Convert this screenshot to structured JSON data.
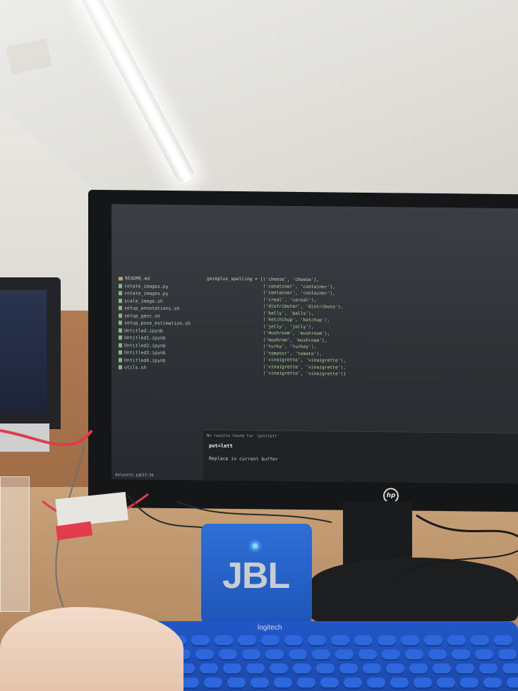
{
  "monitor": {
    "brand_logo": "hp",
    "screen": {
      "file_tree": [
        {
          "name": "README.md",
          "kind": "folder"
        },
        {
          "name": "rotate_images.py",
          "kind": "file"
        },
        {
          "name": "rotate_images.py",
          "kind": "file"
        },
        {
          "name": "scale_image.sh",
          "kind": "file"
        },
        {
          "name": "setup_annotations.sh",
          "kind": "file"
        },
        {
          "name": "setup_ganc.sh",
          "kind": "file"
        },
        {
          "name": "setup_pose_estimation.sh",
          "kind": "file"
        },
        {
          "name": "Untitled.ipynb",
          "kind": "file"
        },
        {
          "name": "Untitled1.ipynb",
          "kind": "file"
        },
        {
          "name": "Untitled2.ipynb",
          "kind": "file"
        },
        {
          "name": "Untitled3.ipynb",
          "kind": "file"
        },
        {
          "name": "Untitled4.ipynb",
          "kind": "file"
        },
        {
          "name": "utils.sh",
          "kind": "file"
        }
      ],
      "code_lines": [
        "gazeplus_spelling = [('cheese', 'cheese'),",
        "                     ('conatiner', 'container'),",
        "                     ('container', 'container'),",
        "                     ('creal', 'cereal'),",
        "                     ('distributer', 'distributo'),",
        "                     ('bally', 'balls'),",
        "                     ('ketchchup', 'ketchup'),",
        "                     ('jelly', 'jelly'),",
        "                     ('mushroom', 'mushroom'),",
        "                     ('mushrom', 'mushroom'),",
        "                     ('turky', 'turkey'),",
        "                     ('tomator', 'tomato'),",
        "                     ('vinaigrette', 'vinaigrette'),",
        "                     ('vinaigrette', 'vinaigrette'),",
        "                     ('vinaigrette', 'vinaigrette')]"
      ],
      "search": {
        "message": "No results found for 'put=lett'",
        "query": "put=lett",
        "replace_label": "Replace in current buffer"
      },
      "status": {
        "file": "datasets.py",
        "position": "133:26"
      }
    }
  },
  "speaker": {
    "logo": "JBL"
  },
  "keyboard": {
    "brand": "logitech"
  }
}
